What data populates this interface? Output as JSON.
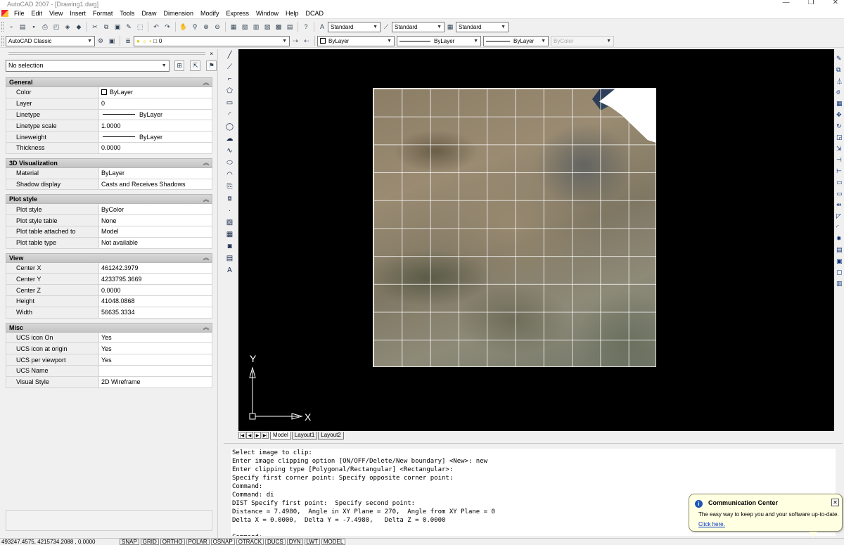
{
  "window": {
    "title": "AutoCAD 2007 - [Drawing1.dwg]"
  },
  "menu": [
    "File",
    "Edit",
    "View",
    "Insert",
    "Format",
    "Tools",
    "Draw",
    "Dimension",
    "Modify",
    "Express",
    "Window",
    "Help",
    "DCAD"
  ],
  "toolbar": {
    "text_style": "Standard",
    "dim_style": "Standard",
    "table_style": "Standard",
    "workspace": "AutoCAD Classic",
    "layer": "0",
    "color": "ByLayer",
    "linetype": "ByLayer",
    "lineweight": "ByLayer",
    "plotstyle": "ByColor"
  },
  "properties": {
    "selection": "No selection",
    "sections": [
      {
        "title": "General",
        "rows": [
          {
            "key": "Color",
            "value": "ByLayer"
          },
          {
            "key": "Layer",
            "value": "0"
          },
          {
            "key": "Linetype",
            "value": "ByLayer"
          },
          {
            "key": "Linetype scale",
            "value": "1.0000"
          },
          {
            "key": "Lineweight",
            "value": "ByLayer"
          },
          {
            "key": "Thickness",
            "value": "0.0000"
          }
        ]
      },
      {
        "title": "3D Visualization",
        "rows": [
          {
            "key": "Material",
            "value": "ByLayer"
          },
          {
            "key": "Shadow display",
            "value": "Casts and Receives Shadows"
          }
        ]
      },
      {
        "title": "Plot style",
        "rows": [
          {
            "key": "Plot style",
            "value": "ByColor"
          },
          {
            "key": "Plot style table",
            "value": "None"
          },
          {
            "key": "Plot table attached to",
            "value": "Model"
          },
          {
            "key": "Plot table type",
            "value": "Not available"
          }
        ]
      },
      {
        "title": "View",
        "rows": [
          {
            "key": "Center X",
            "value": "461242.3979"
          },
          {
            "key": "Center Y",
            "value": "4233795.3669"
          },
          {
            "key": "Center Z",
            "value": "0.0000"
          },
          {
            "key": "Height",
            "value": "41048.0868"
          },
          {
            "key": "Width",
            "value": "56635.3334"
          }
        ]
      },
      {
        "title": "Misc",
        "rows": [
          {
            "key": "UCS icon On",
            "value": "Yes"
          },
          {
            "key": "UCS icon at origin",
            "value": "Yes"
          },
          {
            "key": "UCS per viewport",
            "value": "Yes"
          },
          {
            "key": "UCS Name",
            "value": ""
          },
          {
            "key": "Visual Style",
            "value": "2D Wireframe"
          }
        ]
      }
    ]
  },
  "canvas": {
    "ucs_x": "X",
    "ucs_y": "Y"
  },
  "layout_tabs": [
    "Model",
    "Layout1",
    "Layout2"
  ],
  "command_lines": [
    "Select image to clip:",
    "Enter image clipping option [ON/OFF/Delete/New boundary] <New>: new",
    "Enter clipping type [Polygonal/Rectangular] <Rectangular>:",
    "Specify first corner point: Specify opposite corner point:",
    "Command:",
    "Command: di",
    "DIST Specify first point:  Specify second point:",
    "Distance = 7.4980,  Angle in XY Plane = 270,  Angle from XY Plane = 0",
    "Delta X = 0.0000,  Delta Y = -7.4980,   Delta Z = 0.0000",
    "",
    "Command:"
  ],
  "statusbar": {
    "coords": "493247.4575, 4215734.2088 , 0.0000",
    "buttons": [
      "SNAP",
      "GRID",
      "ORTHO",
      "POLAR",
      "OSNAP",
      "OTRACK",
      "DUCS",
      "DYN",
      "LWT",
      "MODEL"
    ]
  },
  "notification": {
    "title": "Communication Center",
    "message": "The easy way to keep you and your software up-to-date.",
    "link": "Click here."
  }
}
